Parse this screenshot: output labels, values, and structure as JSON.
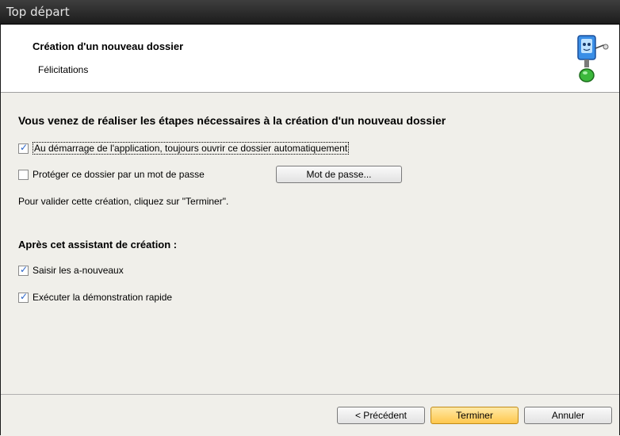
{
  "window": {
    "title": "Top départ"
  },
  "header": {
    "title": "Création d'un nouveau dossier",
    "subtitle": "Félicitations"
  },
  "main": {
    "heading": "Vous venez de réaliser les étapes nécessaires à la création d'un nouveau dossier",
    "open_at_startup": {
      "label": "Au démarrage de l'application, toujours ouvrir ce dossier automatiquement",
      "checked": true
    },
    "protect_password": {
      "label": "Protéger ce dossier par un mot de passe",
      "checked": false
    },
    "password_button": "Mot de passe...",
    "validate_text": "Pour valider cette création, cliquez sur \"Terminer\".",
    "after_heading": "Après cet assistant de création :",
    "enter_balances": {
      "label": "Saisir les a-nouveaux",
      "checked": true
    },
    "run_demo": {
      "label": "Exécuter la démonstration rapide",
      "checked": true
    }
  },
  "footer": {
    "previous": "< Précédent",
    "finish": "Terminer",
    "cancel": "Annuler"
  },
  "icons": {
    "wizard": "computer-mascot-icon",
    "check": "check-icon"
  },
  "colors": {
    "titlebar": "#2a2a2a",
    "accent_check": "#2a64c8",
    "primary_button": "#ffc74d"
  }
}
